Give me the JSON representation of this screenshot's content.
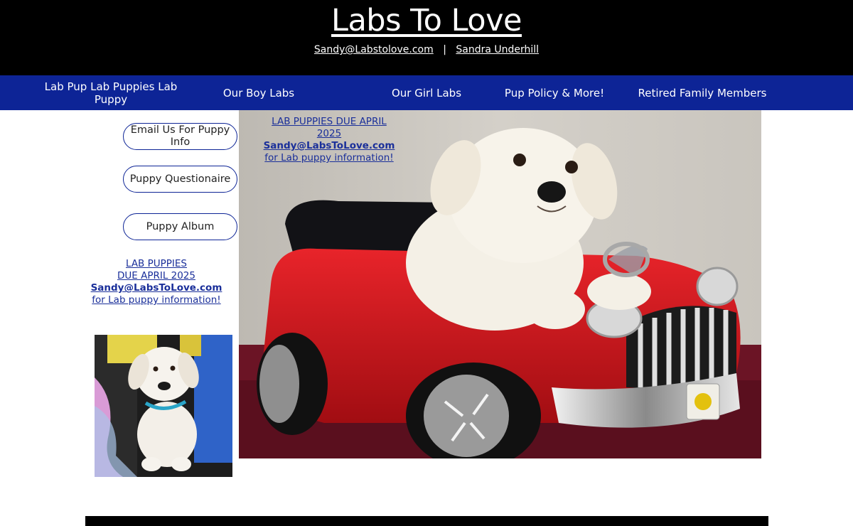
{
  "site": {
    "title": "Labs To Love",
    "email": "Sandy@Labstolove.com",
    "separator": "|",
    "owner": "Sandra Underhill"
  },
  "nav": {
    "items": [
      {
        "label": "Lab Pup Lab Puppies Lab Puppy"
      },
      {
        "label": "Our Boy Labs"
      },
      {
        "label": "Our Girl Labs"
      },
      {
        "label": "Pup Policy & More!"
      },
      {
        "label": "Retired Family Members"
      }
    ]
  },
  "sidebar": {
    "buttons": [
      {
        "label": "Email Us For Puppy Info"
      },
      {
        "label": "Puppy Questionaire"
      },
      {
        "label": "Puppy Album"
      }
    ],
    "promo": {
      "line1": "LAB PUPPIES",
      "line2": "DUE APRIL 2025",
      "email": "Sandy@LabsToLove.com",
      "line4": "for Lab puppy information!"
    }
  },
  "hero_promo": {
    "line1": "LAB PUPPIES DUE APRIL 2025",
    "email": "Sandy@LabsToLove.com",
    "line3": "for Lab puppy information!"
  },
  "colors": {
    "header_bg": "#000000",
    "nav_bg": "#0d2496",
    "link": "#1a2f9a"
  }
}
